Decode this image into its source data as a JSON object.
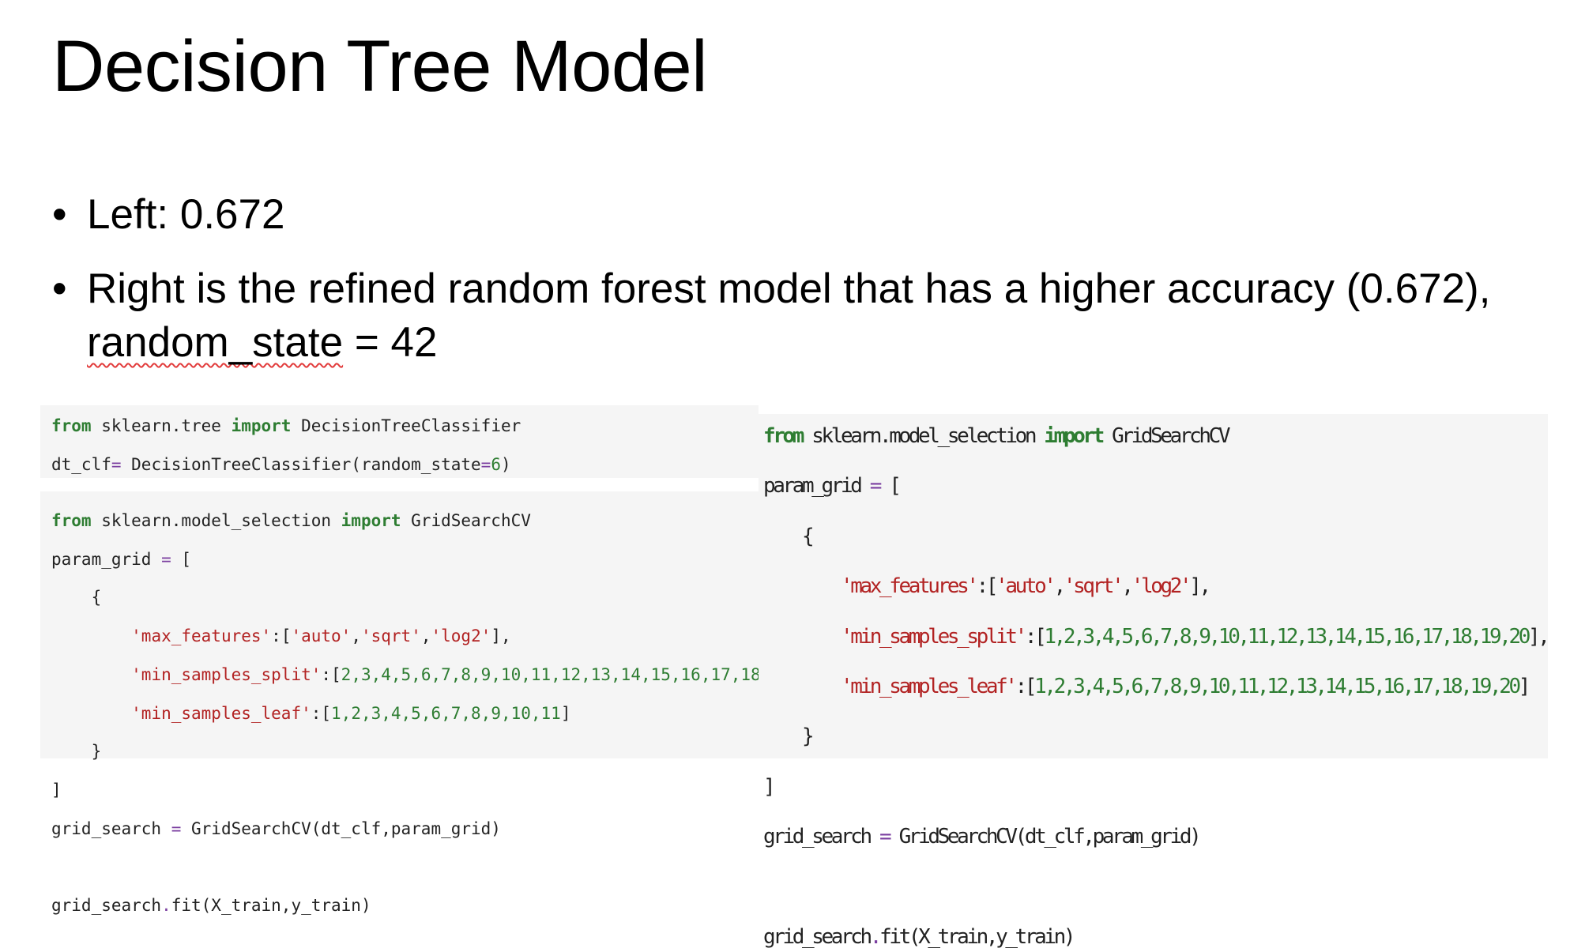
{
  "slide": {
    "title": "Decision Tree Model",
    "bullets": [
      {
        "text": "Left: 0.672"
      },
      {
        "text_before": "Right is the refined random forest model that has a higher accuracy (0.672), ",
        "squiggle_text": "random_state",
        "text_after": " = 42"
      }
    ]
  },
  "code": {
    "left_top": {
      "line1": {
        "kw1": "from",
        "mod": " sklearn.tree ",
        "kw2": "import",
        "name": " DecisionTreeClassifier"
      },
      "line2": {
        "a": "dt_clf",
        "op": "=",
        "b": " DecisionTreeClassifier(random_state",
        "eq": "=",
        "num": "6",
        "c": ")"
      }
    },
    "left_bottom": {
      "l1": {
        "kw1": "from",
        "mod": " sklearn.model_selection ",
        "kw2": "import",
        "name": " GridSearchCV"
      },
      "l2": {
        "a": "param_grid ",
        "op": "=",
        "b": " ["
      },
      "l3": "    {",
      "l4": {
        "indent": "        ",
        "key": "'max_features'",
        "colon": ":[",
        "v1": "'auto'",
        "c1": ",",
        "v2": "'sqrt'",
        "c2": ",",
        "v3": "'log2'",
        "end": "],"
      },
      "l5": {
        "indent": "        ",
        "key": "'min_samples_split'",
        "colon": ":[",
        "nums": "2,3,4,5,6,7,8,9,10,11,12,13,14,15,16,17,18",
        "end": "],"
      },
      "l6": {
        "indent": "        ",
        "key": "'min_samples_leaf'",
        "colon": ":[",
        "nums": "1,2,3,4,5,6,7,8,9,10,11",
        "end": "]"
      },
      "l7": "    }",
      "l8": "]",
      "l9": {
        "a": "grid_search ",
        "op": "=",
        "b": " GridSearchCV(dt_clf,param_grid)"
      },
      "l11": {
        "a": "grid_search",
        "op": ".",
        "b": "fit(X_train,y_train)"
      }
    },
    "right": {
      "l1": {
        "kw1": "from",
        "mod": " sklearn.model_selection ",
        "kw2": "import",
        "name": " GridSearchCV"
      },
      "l2": {
        "a": "param_grid ",
        "op": "=",
        "b": " ["
      },
      "l3": "    {",
      "l4": {
        "indent": "        ",
        "key": "'max_features'",
        "colon": ":[",
        "v1": "'auto'",
        "c1": ",",
        "v2": "'sqrt'",
        "c2": ",",
        "v3": "'log2'",
        "end": "],"
      },
      "l5": {
        "indent": "        ",
        "key": "'min_samples_split'",
        "colon": ":[",
        "nums": "1,2,3,4,5,6,7,8,9,10,11,12,13,14,15,16,17,18,19,20",
        "end": "],"
      },
      "l6": {
        "indent": "        ",
        "key": "'min_samples_leaf'",
        "colon": ":[",
        "nums": "1,2,3,4,5,6,7,8,9,10,11,12,13,14,15,16,17,18,19,20",
        "end": "]"
      },
      "l7": "    }",
      "l8": "]",
      "l9": {
        "a": "grid_search ",
        "op": "=",
        "b": " GridSearchCV(dt_clf,param_grid)"
      },
      "l11": {
        "a": "grid_search",
        "op": ".",
        "b": "fit(X_train,y_train)"
      }
    }
  },
  "colors": {
    "keyword": "#2e7d32",
    "string": "#b22222",
    "number": "#2e7d32",
    "operator": "#7b3fa0",
    "code_background": "#f5f5f5",
    "spellcheck_squiggle": "#e23b3b"
  }
}
